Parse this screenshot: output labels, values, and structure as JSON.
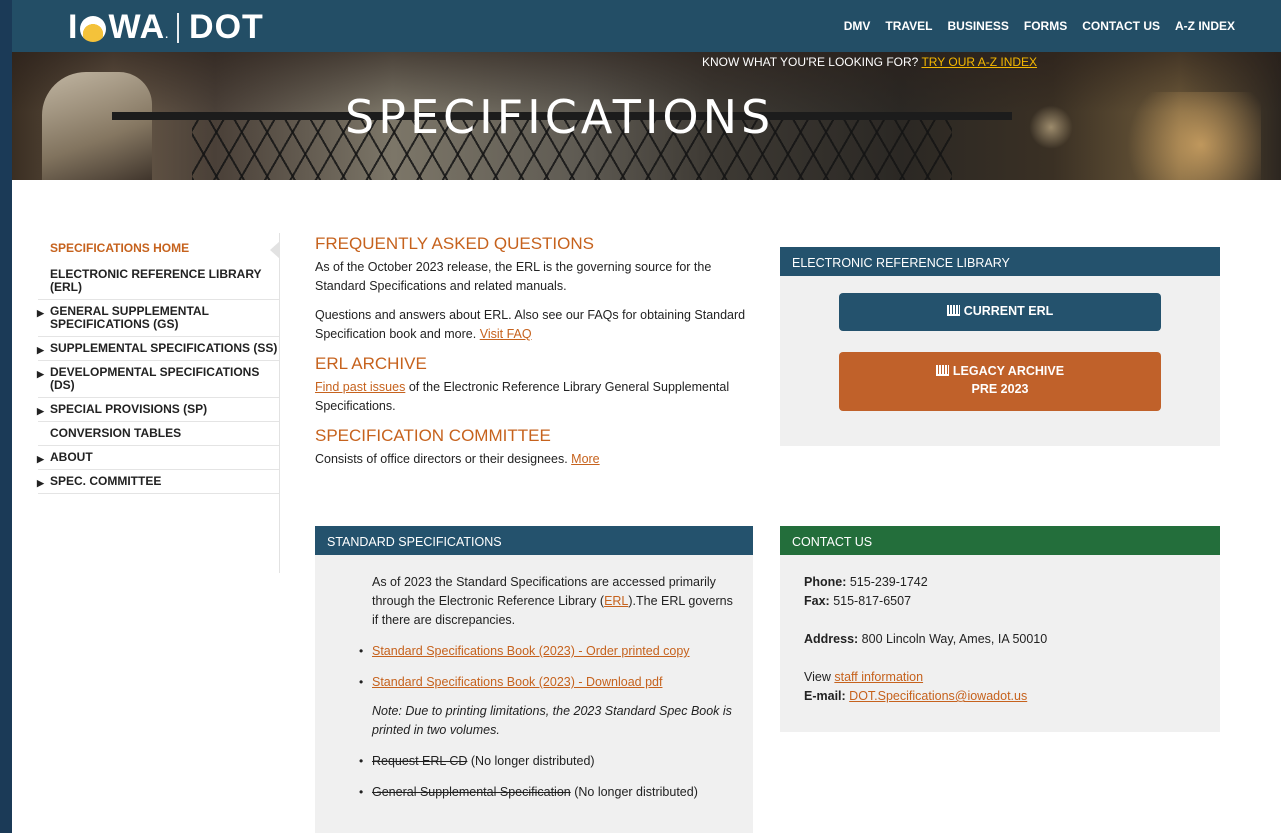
{
  "header": {
    "logo_left": "I",
    "logo_mid": "WA",
    "logo_dot": "DOT",
    "nav": [
      "DMV",
      "TRAVEL",
      "BUSINESS",
      "FORMS",
      "CONTACT US",
      "A-Z INDEX"
    ]
  },
  "hero": {
    "know_text": "KNOW WHAT YOU'RE LOOKING FOR?",
    "know_link": "TRY OUR A-Z INDEX",
    "title": "SPECIFICATIONS"
  },
  "sidebar": {
    "items": [
      {
        "label": "SPECIFICATIONS HOME"
      },
      {
        "label": "ELECTRONIC REFERENCE LIBRARY (ERL)"
      },
      {
        "label": "GENERAL SUPPLEMENTAL SPECIFICATIONS (GS)"
      },
      {
        "label": "SUPPLEMENTAL SPECIFICATIONS (SS)"
      },
      {
        "label": "DEVELOPMENTAL SPECIFICATIONS (DS)"
      },
      {
        "label": "SPECIAL PROVISIONS (SP)"
      },
      {
        "label": "CONVERSION TABLES"
      },
      {
        "label": "ABOUT"
      },
      {
        "label": "SPEC. COMMITTEE"
      }
    ]
  },
  "main": {
    "faq_title": "FREQUENTLY ASKED QUESTIONS",
    "faq_p1": "As of the October 2023 release, the ERL is the governing source for the Standard Specifications and related manuals.",
    "faq_p2": "Questions and answers about ERL. Also see our FAQs for obtaining Standard Specification book and more.",
    "faq_link": "Visit FAQ",
    "archive_title": "ERL ARCHIVE",
    "archive_link": "Find past issues",
    "archive_text": "of the Electronic Reference Library General Supplemental Specifications.",
    "committee_title": "SPECIFICATION COMMITTEE",
    "committee_text": "Consists of office directors or their designees.",
    "committee_link": "More"
  },
  "erl_panel": {
    "header": "ELECTRONIC REFERENCE LIBRARY",
    "btn_current": "CURRENT ERL",
    "btn_legacy_1": "LEGACY ARCHIVE",
    "btn_legacy_2": "PRE 2023"
  },
  "std_panel": {
    "header": "STANDARD SPECIFICATIONS",
    "intro_1": "As of 2023 the Standard Specifications are accessed primarily through the Electronic Reference Library (",
    "intro_link": "ERL",
    "intro_2": ").The ERL governs if there are discrepancies.",
    "link_order": "Standard Specifications Book (2023) - Order printed copy",
    "link_pdf": "Standard Specifications Book (2023) - Download pdf",
    "note": "Note: Due to printing limitations, the 2023 Standard Spec Book is printed in two volumes.",
    "request_strike": "Request ERL CD",
    "request_rest": " (No longer distributed)",
    "general_strike": "General Supplemental Specification",
    "general_rest": " (No longer distributed)"
  },
  "contact_panel": {
    "header": "CONTACT US",
    "phone_label": "Phone:",
    "phone": "515-239-1742",
    "fax_label": "Fax:",
    "fax": "515-817-6507",
    "address_label": "Address:",
    "address": "800 Lincoln Way, Ames, IA 50010",
    "view_text": "View",
    "staff_link": "staff information",
    "email_label": "E-mail:",
    "email": "DOT.Specifications@iowadot.us"
  },
  "colors": {
    "header_blue": "#234e66",
    "accent_orange": "#c6621d",
    "panel_green": "#236e3b",
    "link_gold": "#f5b800"
  }
}
